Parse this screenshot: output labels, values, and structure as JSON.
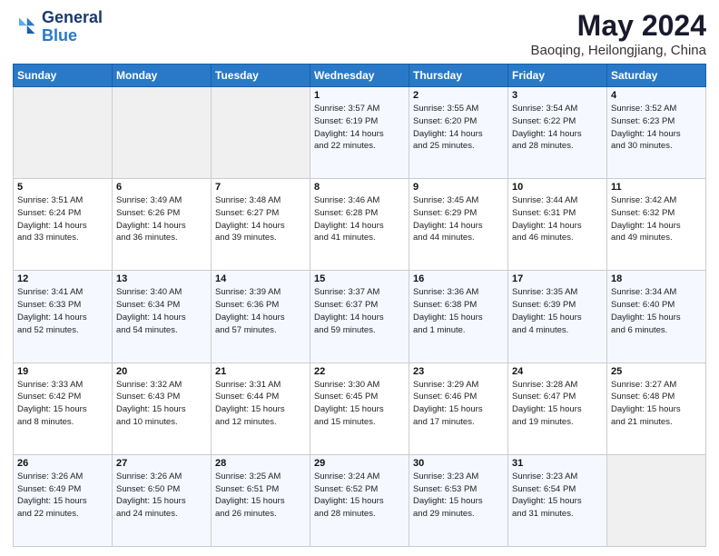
{
  "header": {
    "logo_line1": "General",
    "logo_line2": "Blue",
    "main_title": "May 2024",
    "subtitle": "Baoqing, Heilongjiang, China"
  },
  "calendar": {
    "days_of_week": [
      "Sunday",
      "Monday",
      "Tuesday",
      "Wednesday",
      "Thursday",
      "Friday",
      "Saturday"
    ],
    "weeks": [
      [
        {
          "day": "",
          "info": ""
        },
        {
          "day": "",
          "info": ""
        },
        {
          "day": "",
          "info": ""
        },
        {
          "day": "1",
          "info": "Sunrise: 3:57 AM\nSunset: 6:19 PM\nDaylight: 14 hours\nand 22 minutes."
        },
        {
          "day": "2",
          "info": "Sunrise: 3:55 AM\nSunset: 6:20 PM\nDaylight: 14 hours\nand 25 minutes."
        },
        {
          "day": "3",
          "info": "Sunrise: 3:54 AM\nSunset: 6:22 PM\nDaylight: 14 hours\nand 28 minutes."
        },
        {
          "day": "4",
          "info": "Sunrise: 3:52 AM\nSunset: 6:23 PM\nDaylight: 14 hours\nand 30 minutes."
        }
      ],
      [
        {
          "day": "5",
          "info": "Sunrise: 3:51 AM\nSunset: 6:24 PM\nDaylight: 14 hours\nand 33 minutes."
        },
        {
          "day": "6",
          "info": "Sunrise: 3:49 AM\nSunset: 6:26 PM\nDaylight: 14 hours\nand 36 minutes."
        },
        {
          "day": "7",
          "info": "Sunrise: 3:48 AM\nSunset: 6:27 PM\nDaylight: 14 hours\nand 39 minutes."
        },
        {
          "day": "8",
          "info": "Sunrise: 3:46 AM\nSunset: 6:28 PM\nDaylight: 14 hours\nand 41 minutes."
        },
        {
          "day": "9",
          "info": "Sunrise: 3:45 AM\nSunset: 6:29 PM\nDaylight: 14 hours\nand 44 minutes."
        },
        {
          "day": "10",
          "info": "Sunrise: 3:44 AM\nSunset: 6:31 PM\nDaylight: 14 hours\nand 46 minutes."
        },
        {
          "day": "11",
          "info": "Sunrise: 3:42 AM\nSunset: 6:32 PM\nDaylight: 14 hours\nand 49 minutes."
        }
      ],
      [
        {
          "day": "12",
          "info": "Sunrise: 3:41 AM\nSunset: 6:33 PM\nDaylight: 14 hours\nand 52 minutes."
        },
        {
          "day": "13",
          "info": "Sunrise: 3:40 AM\nSunset: 6:34 PM\nDaylight: 14 hours\nand 54 minutes."
        },
        {
          "day": "14",
          "info": "Sunrise: 3:39 AM\nSunset: 6:36 PM\nDaylight: 14 hours\nand 57 minutes."
        },
        {
          "day": "15",
          "info": "Sunrise: 3:37 AM\nSunset: 6:37 PM\nDaylight: 14 hours\nand 59 minutes."
        },
        {
          "day": "16",
          "info": "Sunrise: 3:36 AM\nSunset: 6:38 PM\nDaylight: 15 hours\nand 1 minute."
        },
        {
          "day": "17",
          "info": "Sunrise: 3:35 AM\nSunset: 6:39 PM\nDaylight: 15 hours\nand 4 minutes."
        },
        {
          "day": "18",
          "info": "Sunrise: 3:34 AM\nSunset: 6:40 PM\nDaylight: 15 hours\nand 6 minutes."
        }
      ],
      [
        {
          "day": "19",
          "info": "Sunrise: 3:33 AM\nSunset: 6:42 PM\nDaylight: 15 hours\nand 8 minutes."
        },
        {
          "day": "20",
          "info": "Sunrise: 3:32 AM\nSunset: 6:43 PM\nDaylight: 15 hours\nand 10 minutes."
        },
        {
          "day": "21",
          "info": "Sunrise: 3:31 AM\nSunset: 6:44 PM\nDaylight: 15 hours\nand 12 minutes."
        },
        {
          "day": "22",
          "info": "Sunrise: 3:30 AM\nSunset: 6:45 PM\nDaylight: 15 hours\nand 15 minutes."
        },
        {
          "day": "23",
          "info": "Sunrise: 3:29 AM\nSunset: 6:46 PM\nDaylight: 15 hours\nand 17 minutes."
        },
        {
          "day": "24",
          "info": "Sunrise: 3:28 AM\nSunset: 6:47 PM\nDaylight: 15 hours\nand 19 minutes."
        },
        {
          "day": "25",
          "info": "Sunrise: 3:27 AM\nSunset: 6:48 PM\nDaylight: 15 hours\nand 21 minutes."
        }
      ],
      [
        {
          "day": "26",
          "info": "Sunrise: 3:26 AM\nSunset: 6:49 PM\nDaylight: 15 hours\nand 22 minutes."
        },
        {
          "day": "27",
          "info": "Sunrise: 3:26 AM\nSunset: 6:50 PM\nDaylight: 15 hours\nand 24 minutes."
        },
        {
          "day": "28",
          "info": "Sunrise: 3:25 AM\nSunset: 6:51 PM\nDaylight: 15 hours\nand 26 minutes."
        },
        {
          "day": "29",
          "info": "Sunrise: 3:24 AM\nSunset: 6:52 PM\nDaylight: 15 hours\nand 28 minutes."
        },
        {
          "day": "30",
          "info": "Sunrise: 3:23 AM\nSunset: 6:53 PM\nDaylight: 15 hours\nand 29 minutes."
        },
        {
          "day": "31",
          "info": "Sunrise: 3:23 AM\nSunset: 6:54 PM\nDaylight: 15 hours\nand 31 minutes."
        },
        {
          "day": "",
          "info": ""
        }
      ]
    ]
  }
}
